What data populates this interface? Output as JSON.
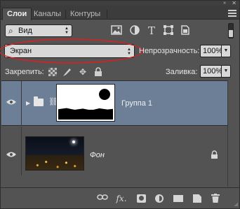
{
  "tabs": [
    {
      "label": "Слои",
      "active": true
    },
    {
      "label": "Каналы",
      "active": false
    },
    {
      "label": "Контуры",
      "active": false
    }
  ],
  "filter": {
    "kind_label": "Вид"
  },
  "blend": {
    "mode": "Экран",
    "opacity_label": "Непрозрачность:",
    "opacity_value": "100%"
  },
  "lock": {
    "label": "Закрепить:",
    "fill_label": "Заливка:",
    "fill_value": "100%"
  },
  "layers": [
    {
      "name": "Группа 1",
      "type": "group",
      "selected": true,
      "visible": true
    },
    {
      "name": "Фон",
      "type": "background",
      "selected": false,
      "visible": true,
      "locked": true
    }
  ],
  "icons": {
    "search": "search-icon",
    "image_filter": "image-filter-icon",
    "adjustment_filter": "adjustment-filter-icon",
    "type_filter": "type-filter-icon",
    "shape_filter": "shape-filter-icon",
    "smart_object_filter": "smart-object-filter-icon"
  },
  "colors": {
    "panel_bg": "#535353",
    "selected_row": "#6d7f96",
    "highlight_ellipse": "#c62828"
  }
}
